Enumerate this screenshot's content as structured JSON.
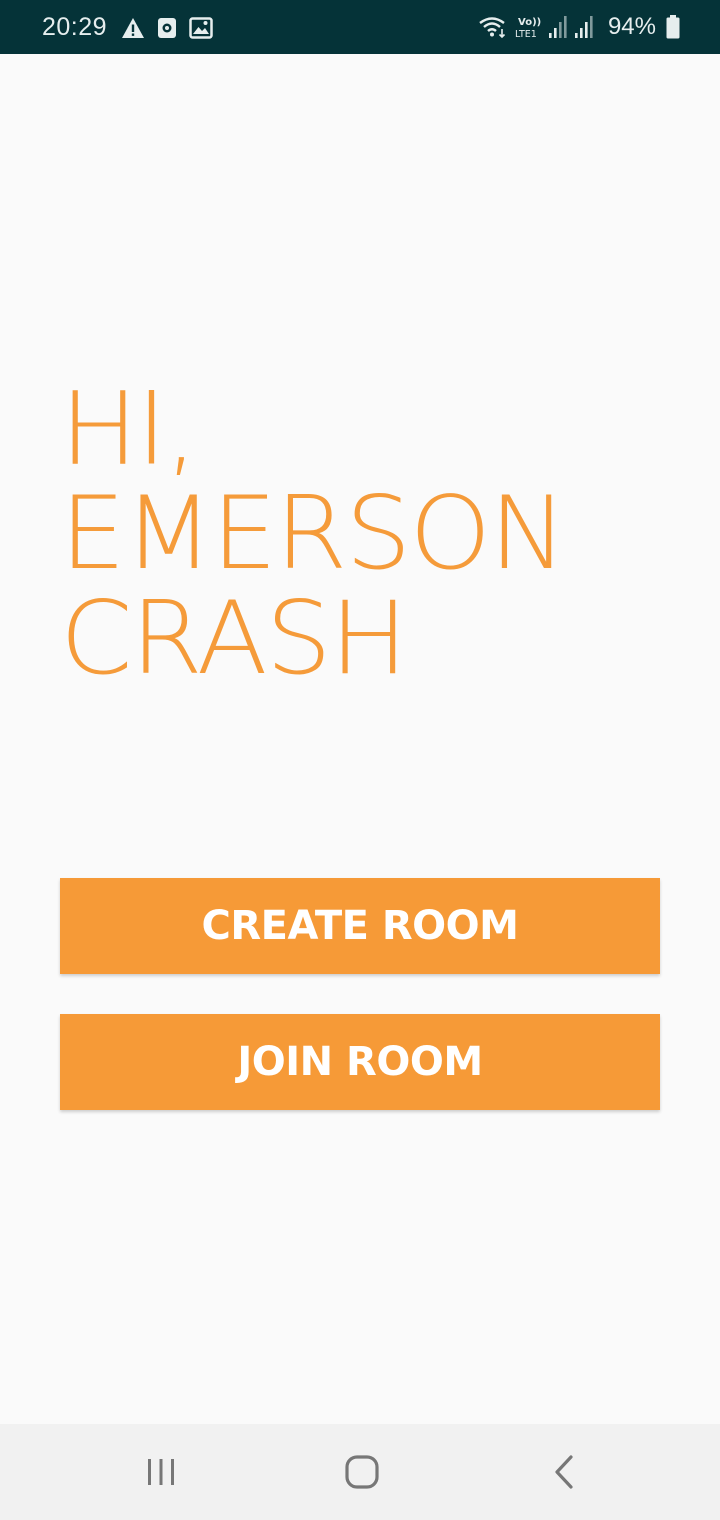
{
  "status_bar": {
    "time": "20:29",
    "battery_percent": "94%",
    "left_icons": [
      "warning-icon",
      "screen-recorder-icon",
      "gallery-icon"
    ],
    "right_icons": [
      "wifi-icon",
      "volte-lte-icon",
      "signal-sim1-icon",
      "signal-sim2-icon",
      "battery-icon"
    ],
    "volte_label": "Vo)) LTE1"
  },
  "greeting": {
    "lines": [
      "HI,",
      "EMERSON",
      "CRASH"
    ]
  },
  "actions": {
    "create_room_label": "CREATE ROOM",
    "join_room_label": "JOIN ROOM"
  },
  "nav_bar": {
    "icons": [
      "recents-icon",
      "home-icon",
      "back-icon"
    ]
  },
  "colors": {
    "accent": "#f69a37",
    "status_bar_bg": "#053338",
    "background": "#fafafa",
    "nav_bar_bg": "#f1f1f1"
  }
}
